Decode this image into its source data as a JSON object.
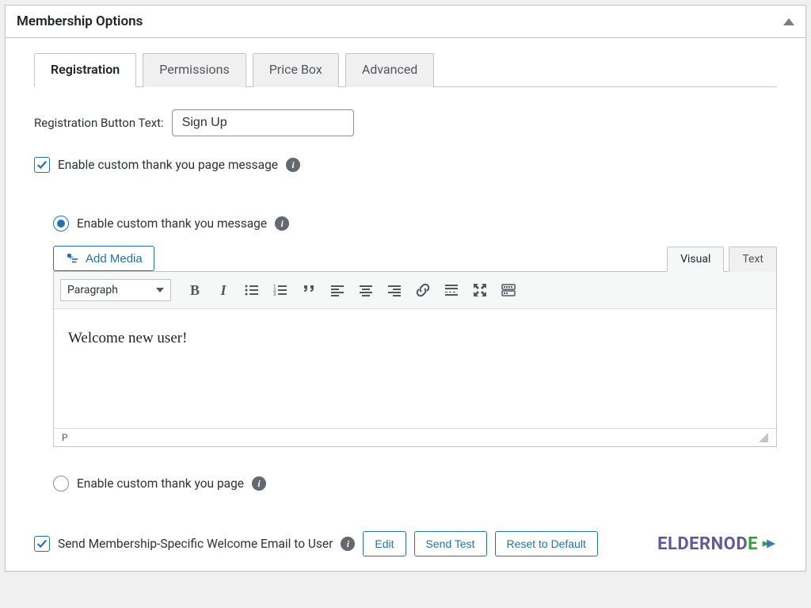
{
  "panel": {
    "title": "Membership Options"
  },
  "tabs": {
    "registration": "Registration",
    "permissions": "Permissions",
    "price_box": "Price Box",
    "advanced": "Advanced"
  },
  "fields": {
    "reg_btn_label": "Registration Button Text:",
    "reg_btn_value": "Sign Up"
  },
  "thank_you": {
    "enable_page_msg": "Enable custom thank you page message",
    "enable_msg_radio": "Enable custom thank you message",
    "enable_page_radio": "Enable custom thank you page"
  },
  "editor": {
    "add_media": "Add Media",
    "visual_tab": "Visual",
    "text_tab": "Text",
    "format_dropdown": "Paragraph",
    "content": "Welcome new user!",
    "path": "P"
  },
  "welcome_email": {
    "label": "Send Membership-Specific Welcome Email to User",
    "edit": "Edit",
    "send_test": "Send Test",
    "reset": "Reset to Default"
  },
  "branding": {
    "name": "ELDERNODE"
  }
}
